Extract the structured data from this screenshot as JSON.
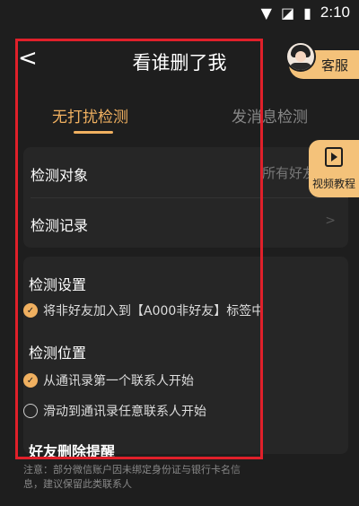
{
  "status": {
    "time": "2:10",
    "icons": [
      "wifi-icon",
      "no-sim-icon",
      "battery-icon"
    ]
  },
  "header": {
    "back_label": "<",
    "title": "看谁删了我",
    "service_label": "客服"
  },
  "tabs": [
    {
      "label": "无打扰检测",
      "active": true
    },
    {
      "label": "发消息检测",
      "active": false
    }
  ],
  "card1": {
    "target_label": "检测对象",
    "target_value": "所有好友",
    "record_label": "检测记录",
    "chevron": ">"
  },
  "video": {
    "label": "视频教程"
  },
  "settings": {
    "title": "检测设置",
    "option": "将非好友加入到【A000非好友】标签中",
    "position_title": "检测位置",
    "pos_opt1": "从通讯录第一个联系人开始",
    "pos_opt2": "滑动到通讯录任意联系人开始",
    "reminder_title": "好友删除提醒",
    "note": "注意：部分微信账户因未绑定身份证与银行卡名信息，建议保留此类联系人"
  },
  "colors": {
    "accent": "#f0b060",
    "highlight_box": "#e0202a",
    "service_bg": "#f4c27a"
  }
}
